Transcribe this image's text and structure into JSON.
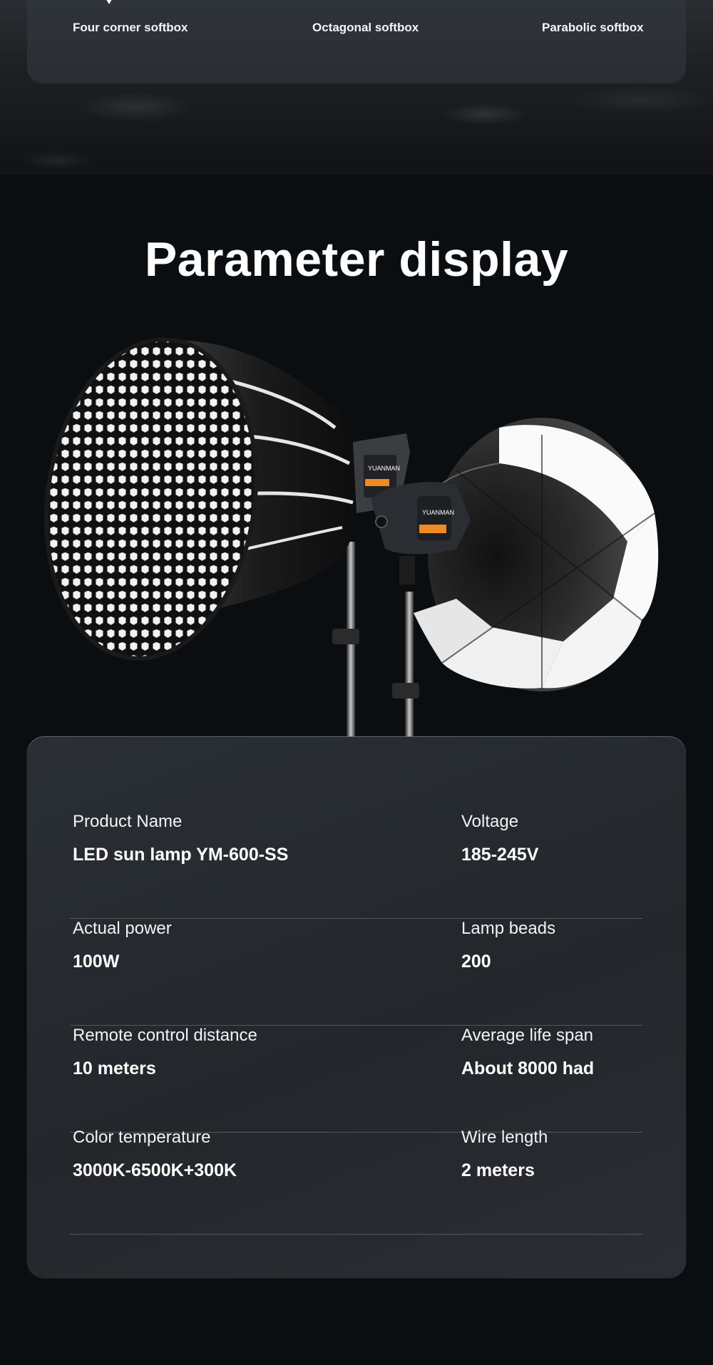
{
  "top_nav": {
    "items": [
      {
        "label": "Four corner softbox"
      },
      {
        "label": "Octagonal softbox"
      },
      {
        "label": "Parabolic softbox"
      }
    ]
  },
  "section": {
    "title": "Parameter display"
  },
  "illustration": {
    "brand_left": "YUANMAN",
    "brand_right": "YUANMAN"
  },
  "parameters": [
    {
      "left": {
        "label": "Product Name",
        "value": "LED sun lamp YM-600-SS"
      },
      "right": {
        "label": "Voltage",
        "value": "185-245V"
      }
    },
    {
      "left": {
        "label": "Actual power",
        "value": "100W"
      },
      "right": {
        "label": "Lamp beads",
        "value": "200"
      }
    },
    {
      "left": {
        "label": "Remote control distance",
        "value": "10 meters"
      },
      "right": {
        "label": "Average life span",
        "value": "About 8000 had"
      }
    },
    {
      "left": {
        "label": "Color temperature",
        "value": "3000K-6500K+300K"
      },
      "right": {
        "label": "Wire length",
        "value": "2 meters"
      }
    }
  ],
  "colors": {
    "page_background": "#0b0e11",
    "card_background": "#2a2e34",
    "accent_orange": "#f08a24"
  }
}
